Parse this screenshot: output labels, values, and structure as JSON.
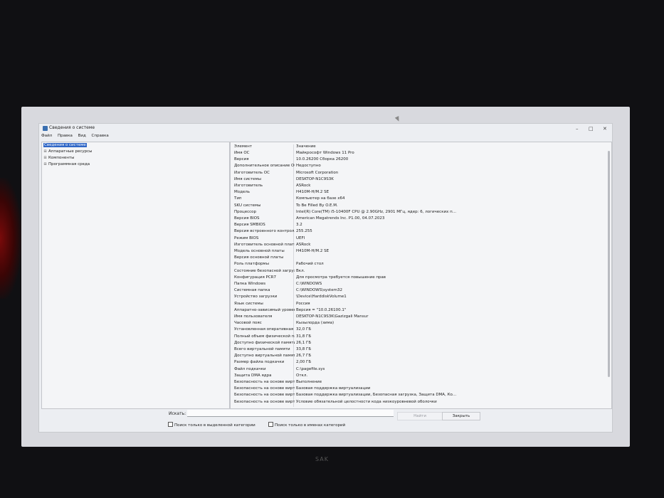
{
  "window": {
    "title": "Сведения о системе",
    "minimize_icon": "minimize-icon",
    "maximize_icon": "maximize-icon",
    "close_icon": "close-icon"
  },
  "menu": [
    "Файл",
    "Правка",
    "Вид",
    "Справка"
  ],
  "tree": {
    "items": [
      {
        "label": "Сведения о системе",
        "selected": true,
        "expandable": false
      },
      {
        "label": "Аппаратные ресурсы",
        "selected": false,
        "expandable": true
      },
      {
        "label": "Компоненты",
        "selected": false,
        "expandable": true
      },
      {
        "label": "Программная среда",
        "selected": false,
        "expandable": true
      }
    ]
  },
  "table": {
    "headers": {
      "key": "Элемент",
      "value": "Значение"
    },
    "rows": [
      [
        "Имя ОС",
        "Майкрософт Windows 11 Pro"
      ],
      [
        "Версия",
        "10.0.26200 Сборка 26200"
      ],
      [
        "Дополнительное описание ОС",
        "Недоступно"
      ],
      [
        "Изготовитель ОС",
        "Microsoft Corporation"
      ],
      [
        "Имя системы",
        "DESKTOP-N1C9S3K"
      ],
      [
        "Изготовитель",
        "ASRock"
      ],
      [
        "Модель",
        "H410M-H/M.2 SE"
      ],
      [
        "Тип",
        "Компьютер на базе x64"
      ],
      [
        "SKU системы",
        "To Be Filled By O.E.M."
      ],
      [
        "Процессор",
        "Intel(R) Core(TM) i5-10400F CPU @ 2.90GHz, 2901 МГц, ядер: 6, логических п..."
      ],
      [
        "Версия BIOS",
        "American Megatrends Inc. P1.00, 04.07.2023"
      ],
      [
        "Версия SMBIOS",
        "3.2"
      ],
      [
        "Версия встроенного контролл...",
        "255.255"
      ],
      [
        "Режим BIOS",
        "UEFI"
      ],
      [
        "Изготовитель основной платы",
        "ASRock"
      ],
      [
        "Модель основной платы",
        "H410M-H/M.2 SE"
      ],
      [
        "Версия основной платы",
        ""
      ],
      [
        "Роль платформы",
        "Рабочий стол"
      ],
      [
        "Состояние безопасной загрузк...",
        "Вкл."
      ],
      [
        "Конфигурация PCR7",
        "Для просмотра требуется повышение прав"
      ],
      [
        "Папка Windows",
        "C:\\WINDOWS"
      ],
      [
        "Системная папка",
        "C:\\WINDOWS\\system32"
      ],
      [
        "Устройство загрузки",
        "\\Device\\HarddiskVolume1"
      ],
      [
        "Язык системы",
        "Россия"
      ],
      [
        "Аппаратно-зависимый уровен...",
        "Версия = \"10.0.26100.1\""
      ],
      [
        "Имя пользователя",
        "DESKTOP-N1C9S3K\\Gazizgali Mansur"
      ],
      [
        "Часовой пояс",
        "Кызылорда (зима)"
      ],
      [
        "Установленная оперативная п...",
        "32,0 ГБ"
      ],
      [
        "Полный объем физической па...",
        "31,8 ГБ"
      ],
      [
        "Доступно физической памяти",
        "26,1 ГБ"
      ],
      [
        "Всего виртуальной памяти",
        "33,8 ГБ"
      ],
      [
        "Доступно виртуальной памяти",
        "26,7 ГБ"
      ],
      [
        "Размер файла подкачки",
        "2,00 ГБ"
      ],
      [
        "Файл подкачки",
        "C:\\pagefile.sys"
      ],
      [
        "Защита DMA ядра",
        "Откл."
      ],
      [
        "Безопасность на основе вирту...",
        "Выполнение"
      ],
      [
        "Безопасность на основе вирту...",
        "Базовая поддержка виртуализации"
      ],
      [
        "Безопасность на основе вирту...",
        "Базовая поддержка виртуализации, Безопасная загрузка, Защита DMA, Ко..."
      ],
      [
        "Безопасность на основе вирту...",
        "Условие обязательной целостности кода низкоуровневой оболочки"
      ]
    ]
  },
  "search": {
    "label": "Искать:",
    "value": "",
    "find_button": "Найти",
    "close_button": "Закрыть",
    "only_selected_category": "Поиск только в выделенной категории",
    "only_category_names": "Поиск только в именах категорий"
  },
  "bezel_brand": "SAK"
}
